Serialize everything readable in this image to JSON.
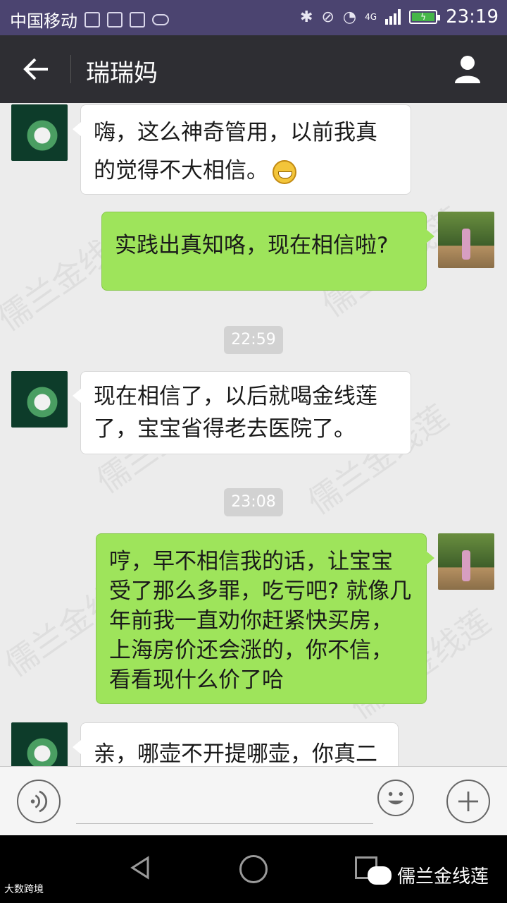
{
  "status_bar": {
    "carrier": "中国移动",
    "network": "4G",
    "time": "23:19",
    "icons": [
      "image-icon",
      "grid-icon",
      "keyboard-icon",
      "cloud-icon",
      "bluetooth-icon",
      "mute-icon",
      "wifi-icon",
      "signal-icon",
      "battery-icon"
    ]
  },
  "header": {
    "title": "瑞瑞妈",
    "back_icon": "arrow-left-icon",
    "profile_icon": "person-icon"
  },
  "messages": [
    {
      "side": "left",
      "text": "嗨，这么神奇管用，以前我真的觉得不大相信。",
      "has_emoji": true
    },
    {
      "side": "right",
      "text": "实践出真知咯，现在相信啦?"
    },
    {
      "side": "time",
      "text": "22:59"
    },
    {
      "side": "left",
      "text": "现在相信了，以后就喝金线莲了，宝宝省得老去医院了。"
    },
    {
      "side": "time",
      "text": "23:08"
    },
    {
      "side": "right",
      "text": "哼，早不相信我的话，让宝宝受了那么多罪，吃亏吧? 就像几年前我一直劝你赶紧快买房，上海房价还会涨的，你不信，看看现什么价了哈"
    },
    {
      "side": "left",
      "text": "亲，哪壶不开提哪壶，你真二"
    }
  ],
  "watermark_text": "儒兰金线莲",
  "brand": {
    "name": "儒兰金线莲",
    "corner_mark": "大数跨境"
  },
  "colors": {
    "status_bar": "#4b4470",
    "header": "#2e2e33",
    "sent_bubble": "#9ee45b",
    "received_bubble": "#ffffff"
  }
}
